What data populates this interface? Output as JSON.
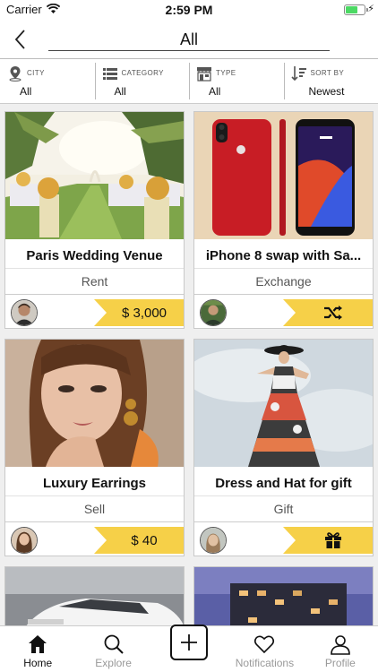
{
  "status_bar": {
    "carrier": "Carrier",
    "time": "2:59 PM"
  },
  "nav": {
    "title": "All"
  },
  "filters": [
    {
      "label": "CITY",
      "value": "All",
      "icon": "location-pin-icon"
    },
    {
      "label": "CATEGORY",
      "value": "All",
      "icon": "list-icon"
    },
    {
      "label": "TYPE",
      "value": "All",
      "icon": "store-icon"
    },
    {
      "label": "SORT BY",
      "value": "Newest",
      "icon": "sort-icon"
    }
  ],
  "listings": [
    {
      "title": "Paris Wedding Venue",
      "type": "Rent",
      "price": "$ 3,000",
      "image": "wedding-venue-photo"
    },
    {
      "title": "iPhone 8 swap with Sa...",
      "type": "Exchange",
      "price": "",
      "image": "red-iphone-photo",
      "tag_icon": "shuffle-icon"
    },
    {
      "title": "Luxury Earrings",
      "type": "Sell",
      "price": "$ 40",
      "image": "earrings-model-photo"
    },
    {
      "title": "Dress and Hat for gift",
      "type": "Gift",
      "price": "",
      "image": "dress-hat-photo",
      "tag_icon": "gift-icon"
    }
  ],
  "partial_listings": [
    {
      "image": "white-car-photo"
    },
    {
      "image": "apartment-building-photo"
    }
  ],
  "tabs": [
    {
      "label": "Home",
      "icon": "home-icon",
      "active": true
    },
    {
      "label": "Explore",
      "icon": "search-icon",
      "active": false
    },
    {
      "label": "",
      "icon": "add-icon",
      "active": false
    },
    {
      "label": "Notifications",
      "icon": "heart-icon",
      "active": false
    },
    {
      "label": "Profile",
      "icon": "user-icon",
      "active": false
    }
  ],
  "colors": {
    "accent": "#f6d048",
    "background": "#efefef"
  }
}
